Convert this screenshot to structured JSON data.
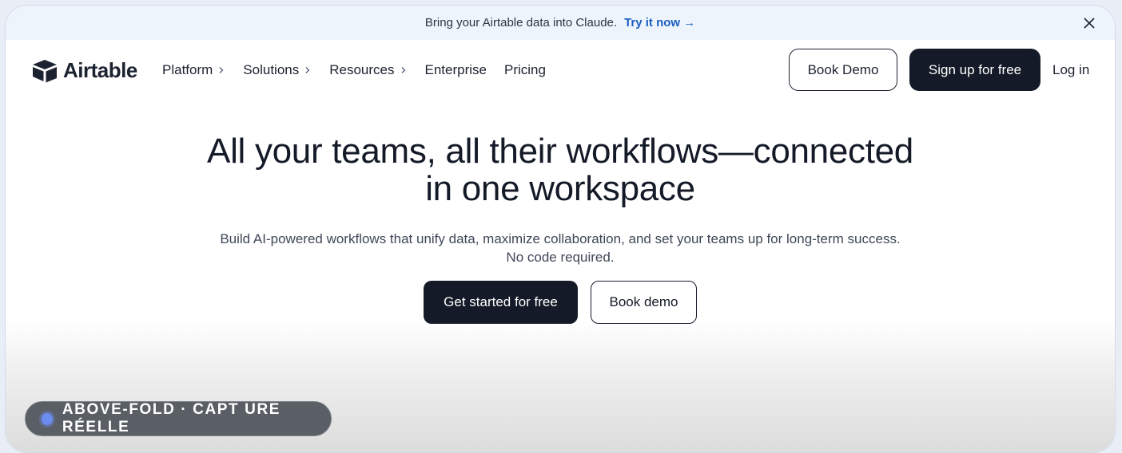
{
  "announcement": {
    "text": "Bring your Airtable data into Claude.",
    "cta_label": "Try it now",
    "arrow": "→"
  },
  "nav": {
    "logo_text": "Airtable",
    "menu": [
      {
        "label": "Platform",
        "has_chevron": true
      },
      {
        "label": "Solutions",
        "has_chevron": true
      },
      {
        "label": "Resources",
        "has_chevron": true
      },
      {
        "label": "Enterprise",
        "has_chevron": false
      },
      {
        "label": "Pricing",
        "has_chevron": false
      }
    ],
    "book_demo_label": "Book Demo",
    "signup_label": "Sign up for free",
    "login_label": "Log in"
  },
  "hero": {
    "title_line1": "All your teams, all their workflows—connected",
    "title_line2": "in one workspace",
    "subtitle_line1": "Build AI-powered workflows that unify data, maximize collaboration, and set your teams up for long-term success.",
    "subtitle_line2": "No code required.",
    "primary_cta": "Get started for free",
    "secondary_cta": "Book demo"
  },
  "badge": {
    "text": "ABOVE-FOLD · CAPT URE RÉELLE"
  },
  "colors": {
    "dark": "#141a27",
    "link": "#1b5fbf",
    "banner_bg": "#eef4fc"
  }
}
